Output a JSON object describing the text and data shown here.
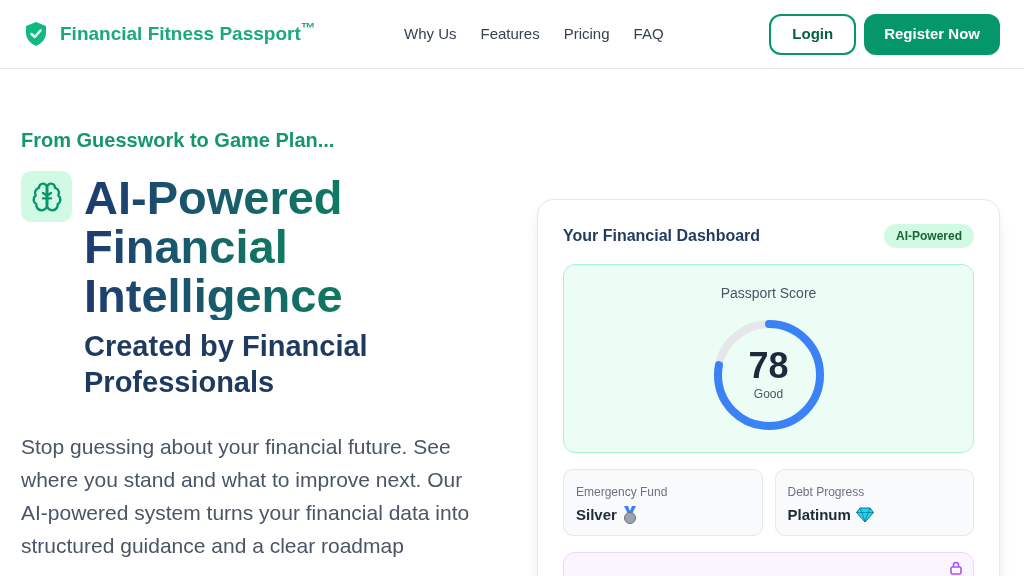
{
  "brand": {
    "name": "Financial Fitness Passport$^{™}$"
  },
  "nav": [
    "Why Us",
    "Features",
    "Pricing",
    "FAQ"
  ],
  "actions": [
    {
      "label": "Login",
      "kind": "outline"
    },
    {
      "label": "Register Now",
      "kind": "solid"
    }
  ],
  "hero": {
    "eyebrow": "From Guesswork to Game Plan...",
    "title": [
      "AI-Powered",
      "Financial",
      "Intelligence"
    ],
    "subtitle": "Created by Financial Professionals",
    "body": "Stop guessing about your financial future. See where you stand and what to improve next. Our AI-powered system turns your financial data into structured guidance and a clear roadmap"
  },
  "dashboard": {
    "title": "Your Financial Dashboard",
    "badge": "AI-Powered",
    "score": {
      "label": "Passport Score",
      "value": "78",
      "rating": "Good",
      "level": 0.78
    },
    "metrics": [
      {
        "label": "Emergency Fund",
        "value": "Silver",
        "kind": "medal"
      },
      {
        "label": "Debt Progress",
        "value": "Platinum",
        "kind": "diamond"
      }
    ]
  }
}
